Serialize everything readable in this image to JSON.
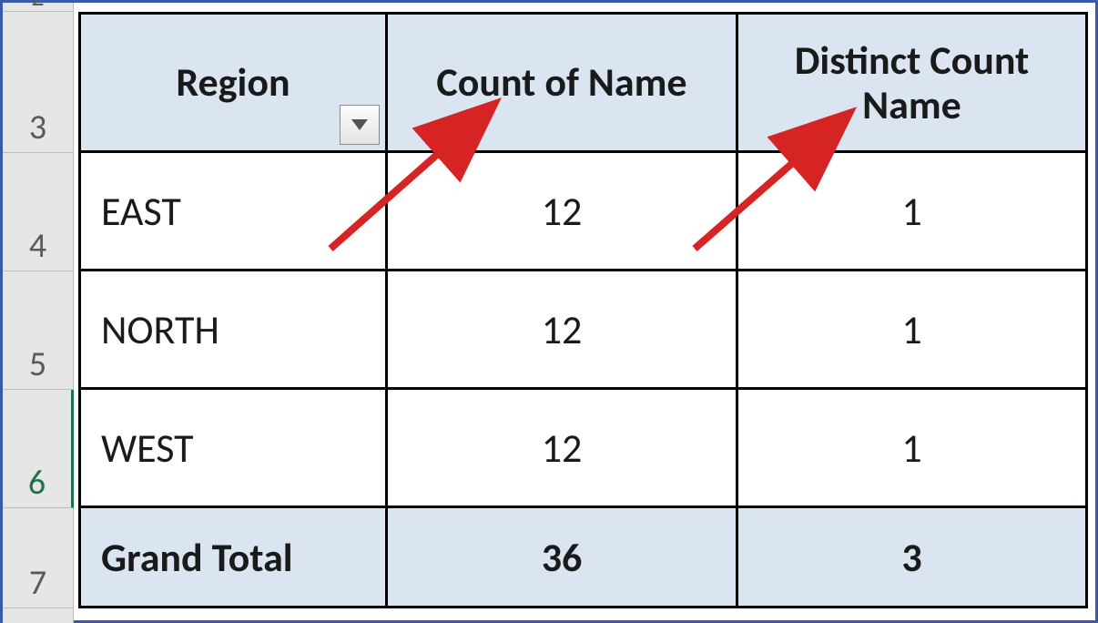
{
  "gutter": {
    "r2": "2",
    "r3": "3",
    "r4": "4",
    "r5": "5",
    "r6": "6",
    "r7": "7"
  },
  "headers": {
    "region": "Region",
    "count": "Count of Name",
    "distinct": "Distinct Count Name"
  },
  "rows": [
    {
      "region": "EAST",
      "count": "12",
      "distinct": "1"
    },
    {
      "region": "NORTH",
      "count": "12",
      "distinct": "1"
    },
    {
      "region": "WEST",
      "count": "12",
      "distinct": "1"
    }
  ],
  "total": {
    "label": "Grand Total",
    "count": "36",
    "distinct": "3"
  },
  "chart_data": {
    "type": "table",
    "title": "",
    "columns": [
      "Region",
      "Count of Name",
      "Distinct Count Name"
    ],
    "rows": [
      [
        "EAST",
        12,
        1
      ],
      [
        "NORTH",
        12,
        1
      ],
      [
        "WEST",
        12,
        1
      ],
      [
        "Grand Total",
        36,
        3
      ]
    ]
  }
}
